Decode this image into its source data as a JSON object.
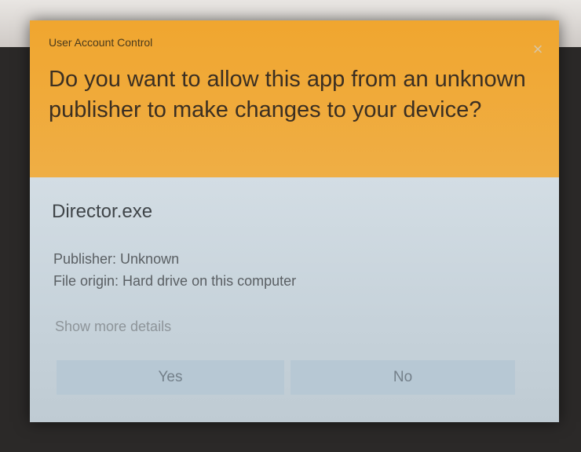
{
  "dialog": {
    "title": "User Account Control",
    "close_glyph": "×",
    "question": "Do you want to allow this app from an unknown publisher to make changes to your device?",
    "app_name": "Director.exe",
    "publisher": "Publisher: Unknown",
    "file_origin": "File origin: Hard drive on this computer",
    "show_more": "Show more details",
    "buttons": {
      "yes": "Yes",
      "no": "No"
    }
  },
  "colors": {
    "header": "#f0a62f",
    "body": "#c9d6df",
    "button": "#b7c8d4"
  },
  "icons": {
    "close": "close-icon"
  }
}
